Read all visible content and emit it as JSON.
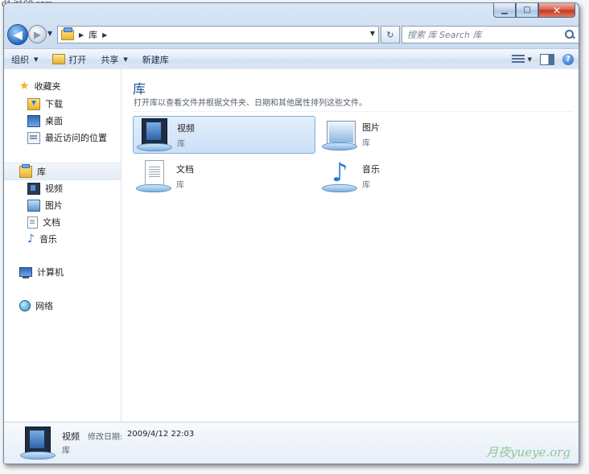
{
  "watermark_top": "d1.it168.com",
  "window": {
    "caption": {
      "minimize": "▁",
      "maximize": "□",
      "close": "✕"
    }
  },
  "address": {
    "back": "◀",
    "forward": "▶",
    "crumb": "库",
    "search_placeholder": "搜索 库 Search 库"
  },
  "toolbar": {
    "organize": "组织",
    "open": "打开",
    "share": "共享",
    "new_library": "新建库",
    "help": "?"
  },
  "sidebar": {
    "favorites": "收藏夹",
    "downloads": "下载",
    "desktop": "桌面",
    "recent_places": "最近访问的位置",
    "libraries": "库",
    "videos": "视频",
    "pictures": "图片",
    "documents": "文档",
    "music": "音乐",
    "computer": "计算机",
    "network": "网络"
  },
  "content": {
    "title": "库",
    "description": "打开库以查看文件并根据文件夹、日期和其他属性排列这些文件。",
    "libraries": [
      {
        "name": "视频",
        "type": "库"
      },
      {
        "name": "图片",
        "type": "库"
      },
      {
        "name": "文档",
        "type": "库"
      },
      {
        "name": "音乐",
        "type": "库"
      }
    ]
  },
  "details": {
    "name": "视频",
    "modified_label": "修改日期:",
    "modified": "2009/4/12 22:03",
    "type": "库"
  },
  "watermark_bottom": "月夜yueye.org",
  "colors": {
    "accent": "#1e4e8c",
    "selection": "#cbe0f6",
    "selection_border": "#84acdd"
  }
}
